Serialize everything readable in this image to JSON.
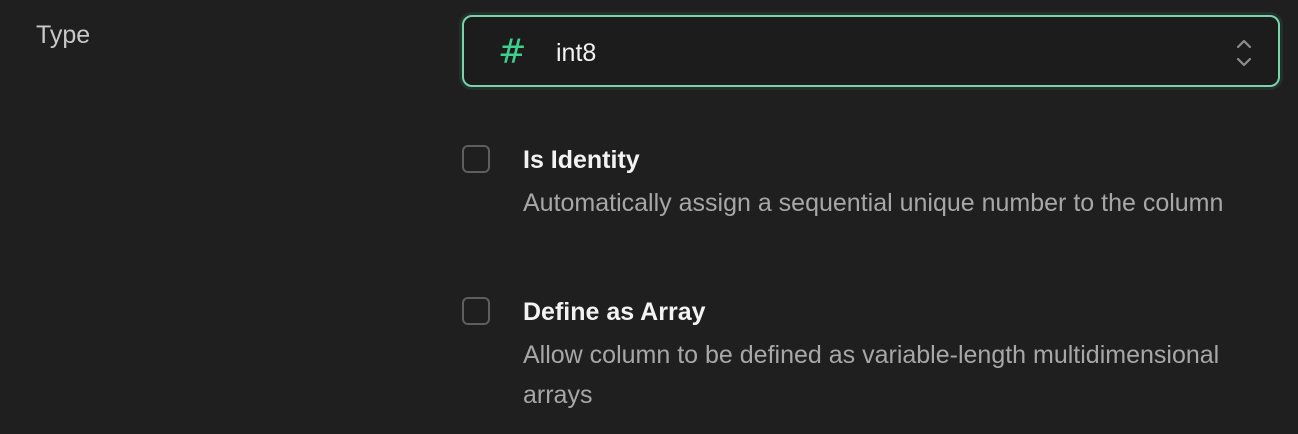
{
  "field": {
    "label": "Type"
  },
  "type_select": {
    "value": "int8",
    "icon": "#",
    "icon_name": "hash-icon",
    "accent_color": "#3ecf8e"
  },
  "options": [
    {
      "checked": false,
      "title": "Is Identity",
      "description": "Automatically assign a sequential unique number to the column"
    },
    {
      "checked": false,
      "title": "Define as Array",
      "description": "Allow column to be defined as variable-length multidimensional arrays"
    }
  ]
}
